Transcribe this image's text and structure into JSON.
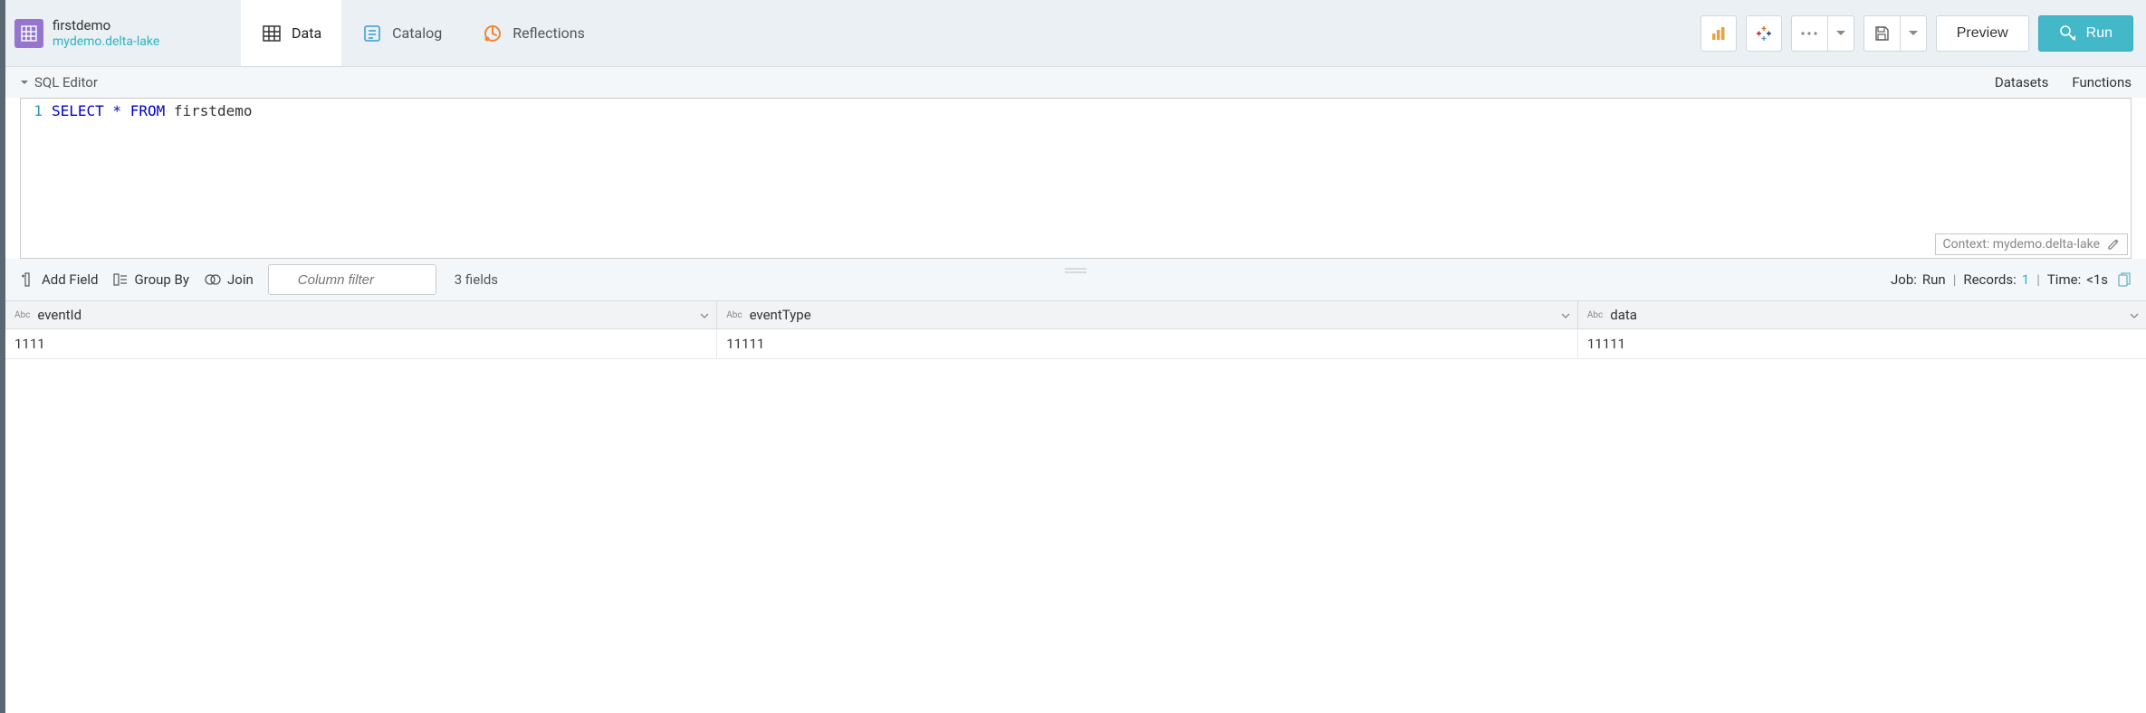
{
  "dataset": {
    "name": "firstdemo",
    "path": "mydemo.delta-lake"
  },
  "tabs": {
    "data": "Data",
    "catalog": "Catalog",
    "reflections": "Reflections"
  },
  "toolbar": {
    "preview": "Preview",
    "run": "Run"
  },
  "editor": {
    "title": "SQL Editor",
    "links": {
      "datasets": "Datasets",
      "functions": "Functions"
    },
    "line_num": "1",
    "code": {
      "select": "SELECT",
      "star": " * ",
      "from": "FROM",
      "table": " firstdemo"
    },
    "context": "Context: mydemo.delta-lake"
  },
  "actions": {
    "add_field": "Add Field",
    "group_by": "Group By",
    "join": "Join",
    "filter_placeholder": "Column filter",
    "fields_count": "3 fields"
  },
  "job": {
    "label": "Job:",
    "run": "Run",
    "records_label": "Records:",
    "records": "1",
    "time_label": "Time:",
    "time": "<1s"
  },
  "columns": [
    "eventId",
    "eventType",
    "data"
  ],
  "rows": [
    [
      "1111",
      "11111",
      "11111"
    ]
  ]
}
